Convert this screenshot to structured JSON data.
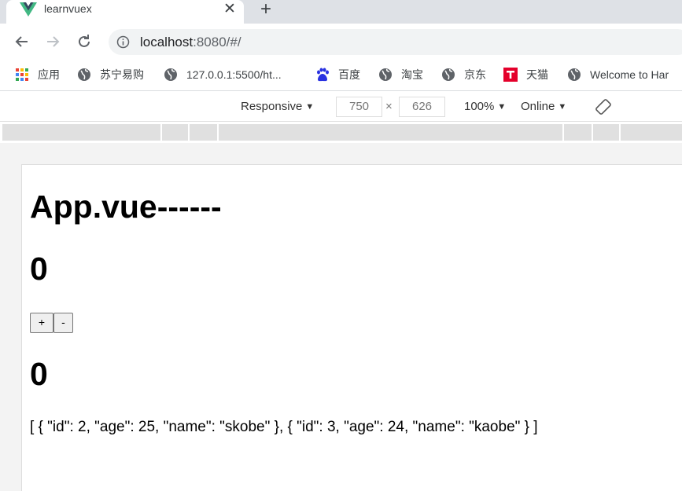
{
  "tab": {
    "title": "learnvuex",
    "close_glyph": "✕",
    "new_tab_glyph": "+"
  },
  "address_bar": {
    "host": "localhost",
    "rest": ":8080/#/"
  },
  "bookmarks": [
    {
      "label": "应用",
      "icon": "apps-grid-icon"
    },
    {
      "label": "苏宁易购",
      "icon": "globe-icon"
    },
    {
      "label": "127.0.0.1:5500/ht...",
      "icon": "globe-icon"
    },
    {
      "label": "百度",
      "icon": "baidu-paw-icon"
    },
    {
      "label": "淘宝",
      "icon": "globe-icon"
    },
    {
      "label": "京东",
      "icon": "globe-icon"
    },
    {
      "label": "天猫",
      "icon": "tmall-icon"
    },
    {
      "label": "Welcome to Har",
      "icon": "globe-icon"
    }
  ],
  "devtools_bar": {
    "device": "Responsive",
    "width": "750",
    "times": "×",
    "height": "626",
    "zoom": "100%",
    "throttle": "Online",
    "caret": "▼"
  },
  "content": {
    "heading": "App.vue------",
    "counter_top": "0",
    "plus_label": "+",
    "minus_label": "-",
    "counter_bottom": "0",
    "list_json": "[ { \"id\": 2, \"age\": 25, \"name\": \"skobe\" }, { \"id\": 3, \"age\": 24, \"name\": \"kaobe\" } ]"
  },
  "colors": {
    "vue_green": "#41b883",
    "vue_dark": "#35495e",
    "tmall_red": "#e4002b",
    "tab_strip": "#dee1e6"
  }
}
